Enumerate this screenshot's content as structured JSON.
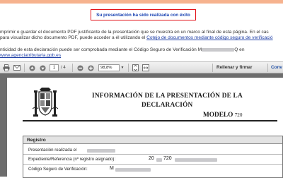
{
  "banner": {
    "success_message": "Su presentación ha sido realizada con éxito"
  },
  "instructions": {
    "line1": "mprimir o guardar el documento PDF justificante de la presentación que se muestra en un marco al final de esta página. En el cas",
    "line2_prefix": "para visualizar dicho documento PDF, puede acceder a él utilizando el ",
    "line2_link": "Cotejo de documentos mediante código seguro de verificació",
    "line3": "nticidad de esta declaración puede ser comprobada mediante el Código Seguro de Verificación M",
    "line3_suffix": "Q en",
    "line4_link": "www.agenciatributaria.gob.es"
  },
  "toolbar": {
    "current_page": "1",
    "page_total": "/ 4",
    "zoom_value": "98,8%",
    "sign_label": "Rellenar y firmar",
    "convert_label": "Conv",
    "icons": [
      "print-icon",
      "email-icon",
      "page-up-icon",
      "page-down-icon",
      "zoom-out-icon",
      "zoom-in-icon",
      "fit-page-icon",
      "fit-width-icon"
    ]
  },
  "document": {
    "title_line1": "INFORMACIÓN DE LA PRESENTACIÓN DE LA",
    "title_line2": "DECLARACIÓN",
    "model_label": "MODELO",
    "model_number": "720",
    "registro_heading": "Registro",
    "fields": [
      {
        "label": "Presentación realizada el"
      },
      {
        "label": "Expediente/Referencia (nº registro asignado):",
        "value_start": "20",
        "value_mid": "720"
      },
      {
        "label": "Código Seguro de Verificación:",
        "value_start": "M"
      }
    ]
  },
  "colors": {
    "banner_border": "#e2141b",
    "banner_text": "#1a43b3",
    "link": "#1f3fa6",
    "viewer_bg": "#6d6d6d"
  }
}
